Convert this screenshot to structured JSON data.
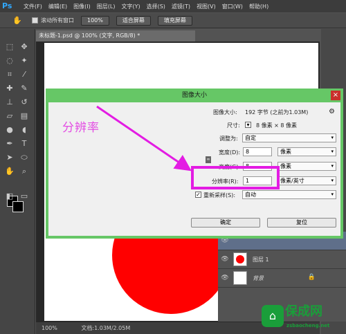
{
  "menubar": {
    "logo": "Ps",
    "items": [
      "文件(F)",
      "编辑(E)",
      "图像(I)",
      "图层(L)",
      "文字(Y)",
      "选择(S)",
      "滤镜(T)",
      "视图(V)",
      "窗口(W)",
      "帮助(H)"
    ]
  },
  "options": {
    "scroll_all": "滚动所有窗口",
    "zoom": "100%",
    "fit_screen": "适合屏幕",
    "fill_screen": "填充屏幕"
  },
  "document": {
    "tab_title": "未标题-1.psd @ 100% (文字, RGB/8) *",
    "status_zoom": "100%",
    "status_doc": "文档:1.03M/2.05M"
  },
  "layers": [
    {
      "name": "图层 1"
    },
    {
      "name": "背景"
    }
  ],
  "dialog": {
    "title": "图像大小",
    "close": "×",
    "image_size_label": "图像大小:",
    "image_size_value": "192 字节 (之前为1.03M)",
    "dimensions_label": "尺寸:",
    "dimensions_value": "8 像素 × 8 像素",
    "fit_label": "调整为:",
    "fit_value": "自定",
    "width_label": "宽度(D):",
    "width_value": "8",
    "width_unit": "像素",
    "height_label": "高度(G):",
    "height_value": "8",
    "height_unit": "像素",
    "resolution_label": "分辨率(R):",
    "resolution_value": "1",
    "resolution_unit": "像素/英寸",
    "resample_label": "重新采样(S):",
    "resample_value": "自动",
    "ok": "确定",
    "reset": "复位"
  },
  "annotation": {
    "label": "分辨率",
    "color": "#e31ce3"
  },
  "watermark": {
    "name": "保成网",
    "url": "zsbaocheng.net",
    "color": "#1a9e3a"
  }
}
